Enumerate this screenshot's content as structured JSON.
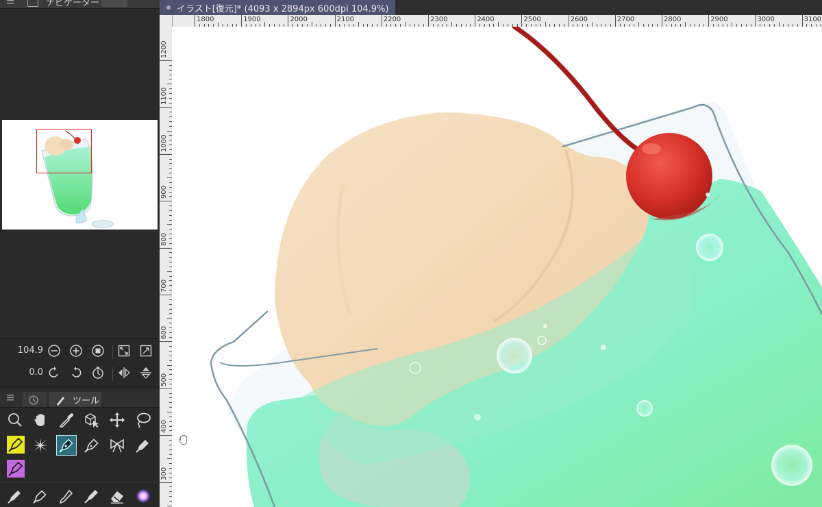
{
  "navigator": {
    "panel_title": "ナビゲーター",
    "zoom_value": "104.9",
    "rotate_value": "0.0",
    "icons": [
      "zoom-out-icon",
      "zoom-in-icon",
      "stop-icon",
      "fit-window-icon",
      "actual-size-icon",
      "rotate-left-icon",
      "rotate-right-icon",
      "reset-rotation-icon",
      "flip-horizontal-icon",
      "flip-vertical-icon"
    ]
  },
  "tool_panel": {
    "tab_label": "ツール",
    "tools_row1": [
      "zoom-icon",
      "hand-icon",
      "eyedropper-icon",
      "3d-operation-icon",
      "move-icon",
      "lasso-icon"
    ],
    "tools_row2": [
      "pen-yellow-icon",
      "sparkle-icon",
      "pen-selected-icon",
      "ink-pen-icon",
      "decorate-bow-icon",
      "marker-icon"
    ],
    "tools_row3": [
      "pen-purple-icon"
    ],
    "tools_row4": [
      "pencil-icon",
      "fountain-pen-icon",
      "brush-icon",
      "airbrush-icon",
      "eraser-icon",
      "color-blend-icon"
    ]
  },
  "document": {
    "tab_title": "イラスト[復元]* (4093 x 2894px 600dpi 104.9%)"
  },
  "ruler": {
    "horizontal": [
      "1800",
      "1900",
      "2000",
      "2100",
      "2200",
      "2300",
      "2400",
      "2500",
      "2600",
      "2700",
      "2800",
      "2900",
      "3000",
      "3100"
    ],
    "vertical": [
      "1200",
      "1100",
      "1000",
      "900",
      "800",
      "700",
      "600",
      "500",
      "400",
      "300"
    ]
  },
  "colors": {
    "selection_rect": "#e02020",
    "cream": "#f4ddbd",
    "soda": "#8ef0cc",
    "cherry": "#d8302a"
  }
}
